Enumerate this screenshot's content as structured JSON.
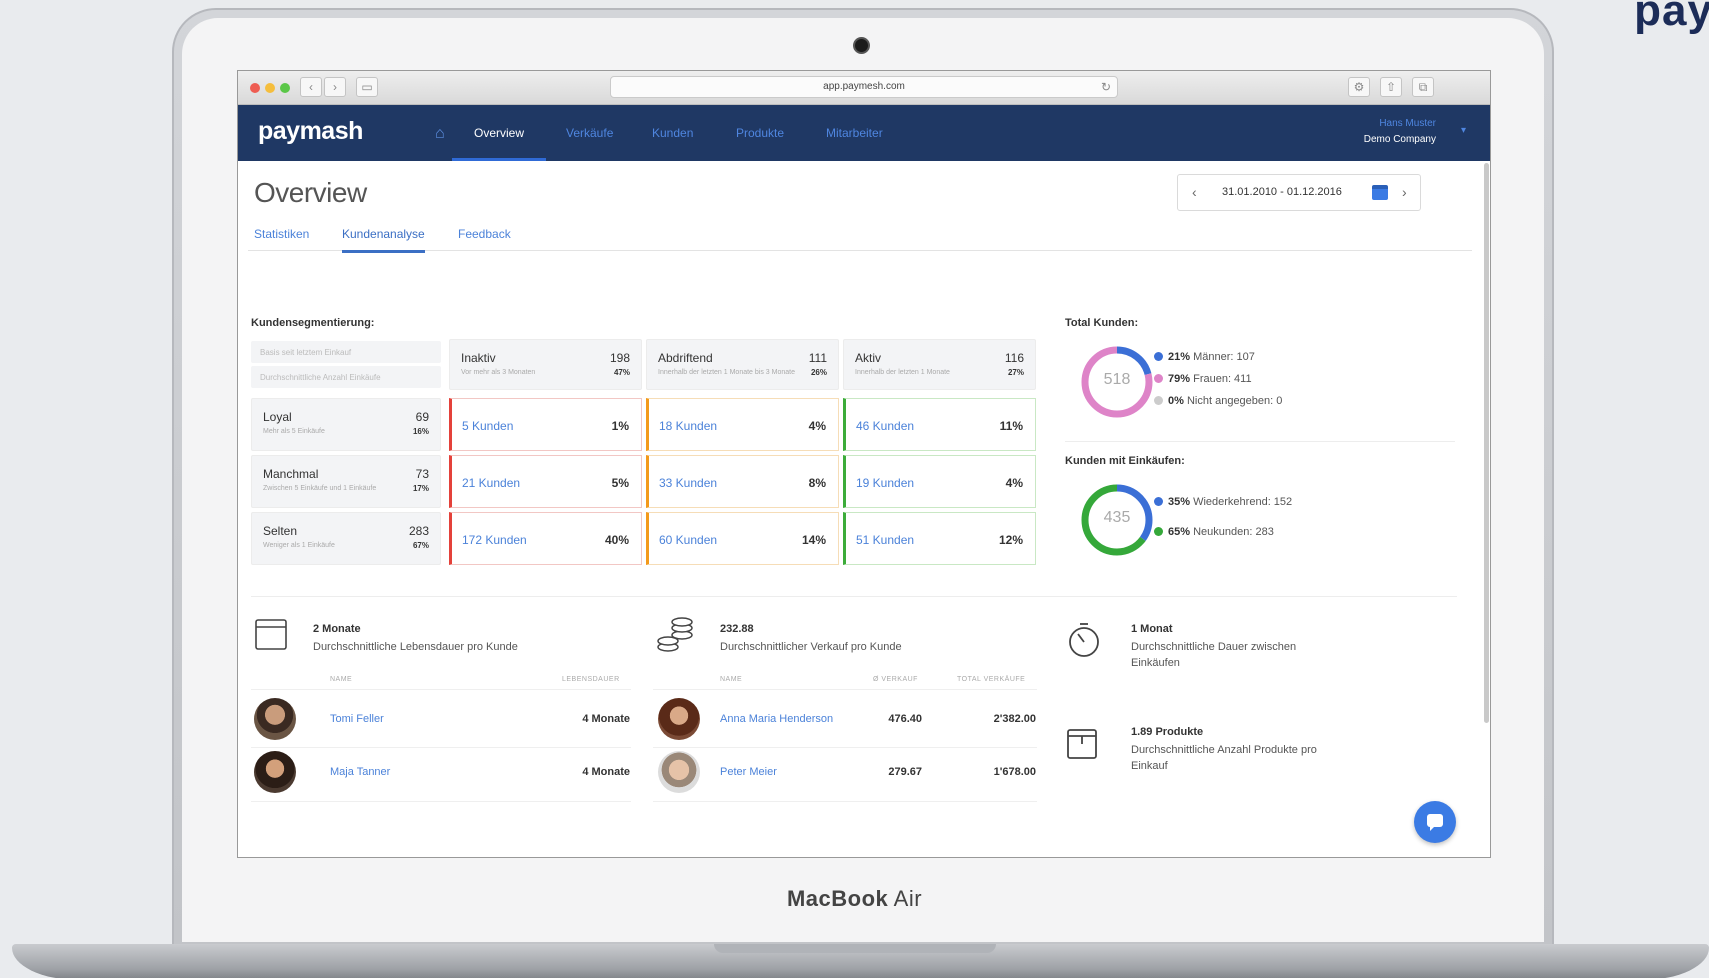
{
  "brand_corner": "pay",
  "laptop": {
    "label_bold": "MacBook",
    "label_regular": " Air"
  },
  "browser": {
    "url": "app.paymesh.com",
    "back": "‹",
    "forward": "›"
  },
  "nav": {
    "logo": "paymash",
    "items": [
      {
        "label": "Overview",
        "active": true
      },
      {
        "label": "Verkäufe"
      },
      {
        "label": "Kunden"
      },
      {
        "label": "Produkte"
      },
      {
        "label": "Mitarbeiter"
      }
    ],
    "user_name": "Hans Muster",
    "company": "Demo Company"
  },
  "page": {
    "title": "Overview",
    "tabs": [
      {
        "label": "Statistiken"
      },
      {
        "label": "Kundenanalyse",
        "active": true
      },
      {
        "label": "Feedback"
      }
    ],
    "date_range": "31.01.2010 - 01.12.2016",
    "prev": "‹",
    "next": "›"
  },
  "segmentation": {
    "title": "Kundensegmentierung:",
    "filter_1": "Basis seit letztem Einkauf",
    "filter_2": "Durchschnittliche Anzahl Einkäufe",
    "columns": [
      {
        "title": "Inaktiv",
        "count": "198",
        "pct": "47%",
        "sub": "Vor mehr als 3 Monaten"
      },
      {
        "title": "Abdriftend",
        "count": "111",
        "pct": "26%",
        "sub": "Innerhalb der letzten 1 Monate bis 3 Monate"
      },
      {
        "title": "Aktiv",
        "count": "116",
        "pct": "27%",
        "sub": "Innerhalb der letzten 1 Monate"
      }
    ],
    "rows": [
      {
        "title": "Loyal",
        "count": "69",
        "pct": "16%",
        "sub": "Mehr als 5 Einkäufe",
        "cells": [
          {
            "label": "5 Kunden",
            "pct": "1%"
          },
          {
            "label": "18 Kunden",
            "pct": "4%"
          },
          {
            "label": "46 Kunden",
            "pct": "11%"
          }
        ]
      },
      {
        "title": "Manchmal",
        "count": "73",
        "pct": "17%",
        "sub": "Zwischen 5 Einkäufe und 1 Einkäufe",
        "cells": [
          {
            "label": "21 Kunden",
            "pct": "5%"
          },
          {
            "label": "33 Kunden",
            "pct": "8%"
          },
          {
            "label": "19 Kunden",
            "pct": "4%"
          }
        ]
      },
      {
        "title": "Selten",
        "count": "283",
        "pct": "67%",
        "sub": "Weniger als 1 Einkäufe",
        "cells": [
          {
            "label": "172 Kunden",
            "pct": "40%"
          },
          {
            "label": "60 Kunden",
            "pct": "14%"
          },
          {
            "label": "51 Kunden",
            "pct": "12%"
          }
        ]
      }
    ]
  },
  "total_customers": {
    "title": "Total Kunden:",
    "total": "518",
    "legend": [
      {
        "pct": "21%",
        "label": "Männer: 107",
        "color": "#3b6fd6"
      },
      {
        "pct": "79%",
        "label": "Frauen: 411",
        "color": "#de84c8"
      },
      {
        "pct": "0%",
        "label": "Nicht angegeben: 0",
        "color": "#cccccc"
      }
    ],
    "shares": [
      0.21,
      0.79,
      0.0
    ]
  },
  "purchasing_customers": {
    "title": "Kunden mit Einkäufen:",
    "total": "435",
    "legend": [
      {
        "pct": "35%",
        "label": "Wiederkehrend: 152",
        "color": "#3b6fd6"
      },
      {
        "pct": "65%",
        "label": "Neukunden: 283",
        "color": "#35a83a"
      }
    ],
    "shares": [
      0.35,
      0.65
    ]
  },
  "lifetime": {
    "value": "2 Monate",
    "desc": "Durchschnittliche Lebensdauer pro Kunde",
    "col_name": "NAME",
    "col_value": "LEBENSDAUER",
    "people": [
      {
        "name": "Tomi Feller",
        "value": "4 Monate"
      },
      {
        "name": "Maja Tanner",
        "value": "4 Monate"
      }
    ]
  },
  "avg_sale": {
    "value": "232.88",
    "desc": "Durchschnittlicher Verkauf pro Kunde",
    "col_name": "NAME",
    "col_avg": "Ø VERKAUF",
    "col_total": "TOTAL VERKÄUFE",
    "people": [
      {
        "name": "Anna Maria Henderson",
        "avg": "476.40",
        "total": "2'382.00"
      },
      {
        "name": "Peter Meier",
        "avg": "279.67",
        "total": "1'678.00"
      }
    ]
  },
  "time_between": {
    "value": "1 Monat",
    "desc": "Durchschnittliche Dauer zwischen Einkäufen"
  },
  "products_per_purchase": {
    "value": "1.89 Produkte",
    "desc": "Durchschnittliche Anzahl Produkte pro Einkauf"
  }
}
